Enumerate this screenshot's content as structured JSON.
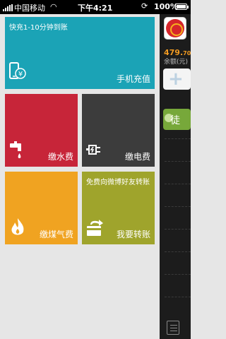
{
  "status_bar": {
    "carrier": "中国移动",
    "time": "下午4:21",
    "battery_pct": "100%"
  },
  "tiles": {
    "mobile_recharge": {
      "promo": "快充1-10分钟到账",
      "label": "手机充值",
      "color": "#1ba3b6",
      "icon": "phone-yen-icon"
    },
    "water": {
      "label": "缴水费",
      "color": "#c72539",
      "icon": "faucet-icon"
    },
    "electricity": {
      "label": "缴电费",
      "color": "#3c3c3c",
      "icon": "plug-icon"
    },
    "gas": {
      "label": "缴煤气费",
      "color": "#f0a321",
      "icon": "flame-icon"
    },
    "transfer": {
      "promo": "免费向微博好友转账",
      "label": "我要转账",
      "color": "#9fa42c",
      "icon": "card-transfer-icon"
    }
  },
  "sidebar": {
    "balance_int": "479.",
    "balance_dec": "70",
    "balance_label": "余额(元)",
    "green_button_text": "徒"
  }
}
